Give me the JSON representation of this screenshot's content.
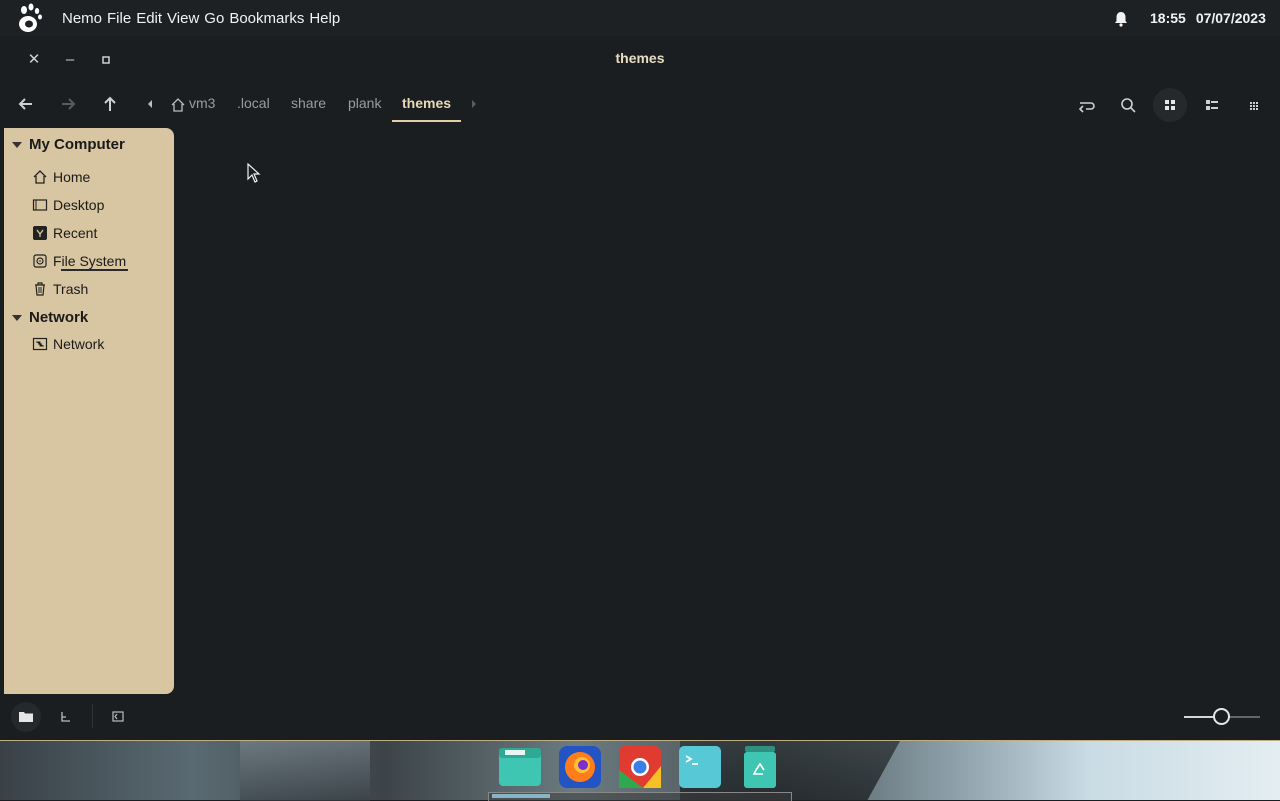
{
  "top_panel": {
    "app_name": "Nemo",
    "menus": [
      "File",
      "Edit",
      "View",
      "Go",
      "Bookmarks",
      "Help"
    ],
    "time": "18:55",
    "date": "07/07/2023"
  },
  "window": {
    "title": "themes"
  },
  "breadcrumbs": {
    "items": [
      "vm3",
      ".local",
      "share",
      "plank",
      "themes"
    ],
    "active": "themes"
  },
  "sidebar": {
    "my_computer_label": "My Computer",
    "my_computer_items": [
      "Home",
      "Desktop",
      "Recent",
      "File System",
      "Trash"
    ],
    "network_label": "Network",
    "network_items": [
      "Network"
    ]
  },
  "zoom": {
    "level": 0.5
  },
  "colors": {
    "sidebar_bg": "#d8c5a1",
    "accent": "#e2cfa6",
    "window_bg": "#1b1e20"
  }
}
